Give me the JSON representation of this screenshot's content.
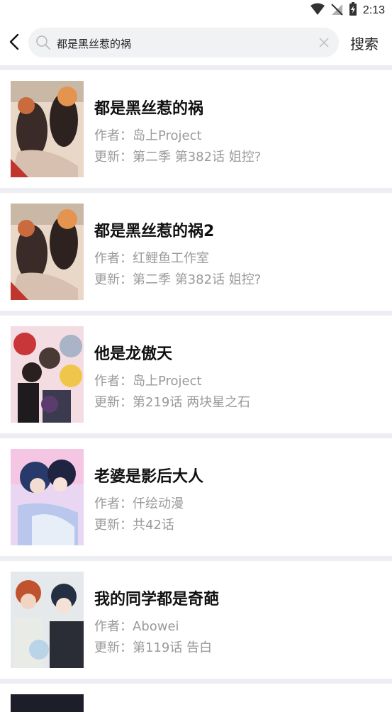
{
  "status": {
    "time": "2:13"
  },
  "search": {
    "value": "都是黑丝惹的祸",
    "placeholder": "",
    "button_label": "搜索"
  },
  "labels": {
    "author_prefix": "作者：",
    "update_prefix": "更新："
  },
  "results": [
    {
      "title": "都是黑丝惹的祸",
      "author": "岛上Project",
      "update": "第二季 第382话 姐控?"
    },
    {
      "title": "都是黑丝惹的祸2",
      "author": "红鲤鱼工作室",
      "update": "第二季 第382话 姐控?"
    },
    {
      "title": "他是龙傲天",
      "author": "岛上Project",
      "update": "第219话 两块星之石"
    },
    {
      "title": "老婆是影后大人",
      "author": "仟绘动漫",
      "update": "共42话"
    },
    {
      "title": "我的同学都是奇葩",
      "author": "Abowei",
      "update": "第119话 告白"
    }
  ],
  "icons": {
    "back": "back-arrow-icon",
    "search": "search-icon",
    "clear": "clear-icon",
    "wifi": "wifi-icon",
    "signal": "no-signal-icon",
    "battery": "battery-charging-icon"
  }
}
